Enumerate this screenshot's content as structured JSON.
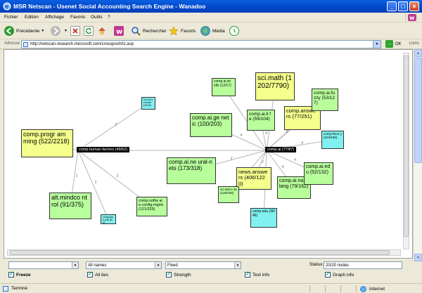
{
  "window": {
    "title": "MSR Netscan - Usenet Social Accounting Search Engine - Wanadoo"
  },
  "menu": {
    "items": [
      "Fichier",
      "Edition",
      "Affichage",
      "Favoris",
      "Outils",
      "?"
    ]
  },
  "toolbar": {
    "back_label": "Précédente",
    "search_label": "Rechercher",
    "favorites_label": "Favoris",
    "media_label": "Média"
  },
  "address": {
    "label": "Adresse",
    "url": "http://netscan.research.microsoft.com/crosspostViz.asp",
    "go_label": "OK",
    "links_label": "Liens"
  },
  "graph": {
    "hubs": [
      {
        "label": "comp.human-factors (49/62)"
      },
      {
        "label": "comp.ai (77/87)"
      }
    ],
    "nodes": [
      {
        "text": "comp.progr amming (522/2218)",
        "color": "yellow"
      },
      {
        "text": "alt.mindco ntrol (91/375)",
        "color": "green"
      },
      {
        "text": "k12.ed.sci ence (10/16)",
        "color": "cyan"
      },
      {
        "text": "comp.sys.h p48 (3/4)",
        "color": "cyan"
      },
      {
        "text": "comp.softw are.config-mgmt (121/325)",
        "color": "green"
      },
      {
        "text": "comp.ai.ne ural-nets (173/318)",
        "color": "green"
      },
      {
        "text": "comp.ai.ge netic (100/203)",
        "color": "green"
      },
      {
        "text": "comp.ai.sh ells (12/17)",
        "color": "green"
      },
      {
        "text": "sci.math (1202/7790)",
        "color": "yellow"
      },
      {
        "text": "comp.ai.li fe (59/104)",
        "color": "green"
      },
      {
        "text": "comp.answe rs (77/251)",
        "color": "yellow"
      },
      {
        "text": "comp.ai.fu zzy (53/127)",
        "color": "green"
      },
      {
        "text": "comp.theor y (104/165)",
        "color": "cyan"
      },
      {
        "text": "news.answe rs (406/1220)",
        "color": "yellow"
      },
      {
        "text": "comp.ai.na t-lang (79/162)",
        "color": "green"
      },
      {
        "text": "comp.ai.ed u (52/132)",
        "color": "green"
      },
      {
        "text": "sci.stat.e du (128/346)",
        "color": "green"
      },
      {
        "text": "comp.edu (30/46)",
        "color": "cyan"
      }
    ],
    "edges_left": [
      "2",
      "2",
      "2",
      "2",
      "2",
      "2"
    ],
    "edges_right": [
      "2",
      "4",
      "4",
      "4",
      "4",
      "5",
      "4",
      "4",
      "2",
      "4",
      "4",
      "4",
      "4",
      "4"
    ]
  },
  "controls": {
    "names_select": "All names",
    "layout_select": "Fixed",
    "status_label": "Status:",
    "status_value": "20/20 nodes"
  },
  "checks": [
    {
      "label": "Freeze",
      "checked": true,
      "bold": true
    },
    {
      "label": "All ties",
      "checked": true,
      "bold": false
    },
    {
      "label": "Strength",
      "checked": true,
      "bold": false
    },
    {
      "label": "Text info",
      "checked": true,
      "bold": false
    },
    {
      "label": "Graph info",
      "checked": true,
      "bold": false
    }
  ],
  "statusbar": {
    "done_label": "Terminé",
    "zone_label": "Internet"
  },
  "colors": {
    "yellow": "#f4ff8c",
    "green": "#b8ff9c",
    "cyan": "#80f0f0",
    "hub": "#000000",
    "titlebar": "#0047c9"
  }
}
